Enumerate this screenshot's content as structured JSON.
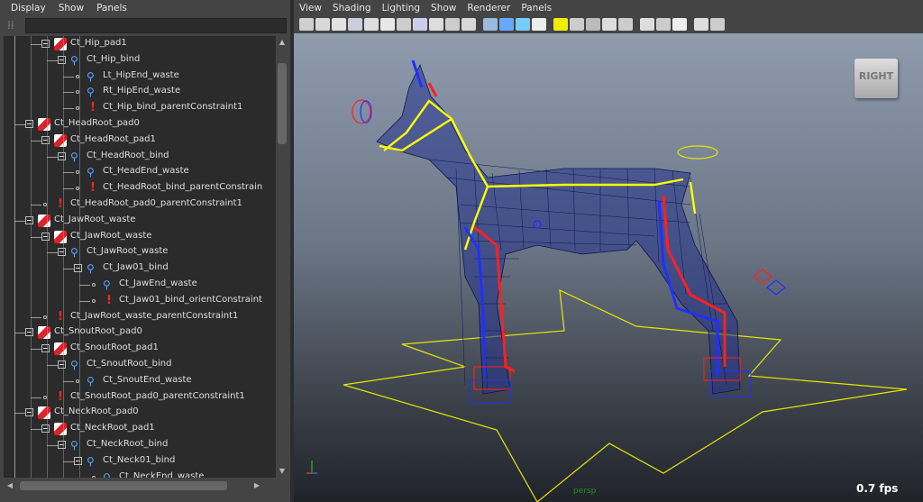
{
  "outliner": {
    "menu": [
      "Display",
      "Show",
      "Panels"
    ],
    "search_value": "",
    "rows": [
      {
        "label": "Ct_Hip_pad1",
        "type": "pad",
        "depth": 1
      },
      {
        "label": "Ct_Hip_bind",
        "type": "joint",
        "depth": 2
      },
      {
        "label": "Lt_HipEnd_waste",
        "type": "joint",
        "depth": 3
      },
      {
        "label": "Rt_HipEnd_waste",
        "type": "joint",
        "depth": 3
      },
      {
        "label": "Ct_Hip_bind_parentConstraint1",
        "type": "constraint",
        "depth": 3
      },
      {
        "label": "Ct_HeadRoot_pad0",
        "type": "pad",
        "depth": 0
      },
      {
        "label": "Ct_HeadRoot_pad1",
        "type": "pad",
        "depth": 1
      },
      {
        "label": "Ct_HeadRoot_bind",
        "type": "joint",
        "depth": 2
      },
      {
        "label": "Ct_HeadEnd_waste",
        "type": "joint",
        "depth": 3
      },
      {
        "label": "Ct_HeadRoot_bind_parentConstrain",
        "type": "constraint",
        "depth": 3
      },
      {
        "label": "Ct_HeadRoot_pad0_parentConstraint1",
        "type": "constraint",
        "depth": 1
      },
      {
        "label": "Ct_JawRoot_waste",
        "type": "pad",
        "depth": 0
      },
      {
        "label": "Ct_JawRoot_waste",
        "type": "pad",
        "depth": 1
      },
      {
        "label": "Ct_JawRoot_waste",
        "type": "joint",
        "depth": 2
      },
      {
        "label": "Ct_Jaw01_bind",
        "type": "joint",
        "depth": 3
      },
      {
        "label": "Ct_JawEnd_waste",
        "type": "joint",
        "depth": 4
      },
      {
        "label": "Ct_Jaw01_bind_orientConstraint",
        "type": "constraint",
        "depth": 4
      },
      {
        "label": "Ct_JawRoot_waste_parentConstraint1",
        "type": "constraint",
        "depth": 1
      },
      {
        "label": "Ct_SnoutRoot_pad0",
        "type": "pad",
        "depth": 0
      },
      {
        "label": "Ct_SnoutRoot_pad1",
        "type": "pad",
        "depth": 1
      },
      {
        "label": "Ct_SnoutRoot_bind",
        "type": "joint",
        "depth": 2
      },
      {
        "label": "Ct_SnoutEnd_waste",
        "type": "joint",
        "depth": 3
      },
      {
        "label": "Ct_SnoutRoot_pad0_parentConstraint1",
        "type": "constraint",
        "depth": 1
      },
      {
        "label": "Ct_NeckRoot_pad0",
        "type": "pad",
        "depth": 0
      },
      {
        "label": "Ct_NeckRoot_pad1",
        "type": "pad",
        "depth": 1
      },
      {
        "label": "Ct_NeckRoot_bind",
        "type": "joint",
        "depth": 2
      },
      {
        "label": "Ct_Neck01_bind",
        "type": "joint",
        "depth": 3
      },
      {
        "label": "Ct_NeckEnd_waste",
        "type": "joint",
        "depth": 4
      }
    ]
  },
  "viewport": {
    "menu": [
      "View",
      "Shading",
      "Lighting",
      "Show",
      "Renderer",
      "Panels"
    ],
    "view_cube": "RIGHT",
    "camera": "persp",
    "fps": "0.7 fps",
    "toolbar_icons": [
      "camera-icon",
      "attributes-icon",
      "bookmark-icon",
      "image-plane-icon",
      "grid-icon",
      "film-gate-icon",
      "resolution-gate-icon",
      "gate-mask-icon",
      "field-chart-icon",
      "safe-action-icon",
      "safe-title-icon",
      "wireframe-icon",
      "smooth-shade-icon",
      "default-material-icon",
      "textured-icon",
      "lights-icon",
      "shadows-icon",
      "screen-space-ao-icon",
      "motion-blur-icon",
      "multisample-icon",
      "xray-icon",
      "xray-joints-icon",
      "isolate-select-icon",
      "resolution-icon",
      "share-icon"
    ],
    "colors": {
      "mesh": "#1a2a8a",
      "skeleton": "#ffff00",
      "left_limb": "#ff2020",
      "right_limb": "#2030ff"
    }
  }
}
